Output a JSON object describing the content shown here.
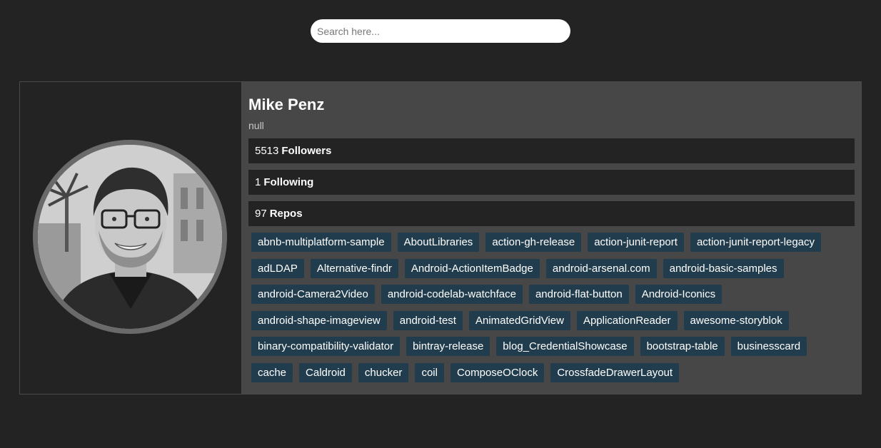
{
  "search": {
    "placeholder": "Search here..."
  },
  "profile": {
    "name": "Mike Penz",
    "bio": "null",
    "stats": [
      {
        "value": "5513",
        "label": "Followers"
      },
      {
        "value": "1",
        "label": "Following"
      },
      {
        "value": "97",
        "label": "Repos"
      }
    ],
    "repos": [
      "abnb-multiplatform-sample",
      "AboutLibraries",
      "action-gh-release",
      "action-junit-report",
      "action-junit-report-legacy",
      "adLDAP",
      "Alternative-findr",
      "Android-ActionItemBadge",
      "android-arsenal.com",
      "android-basic-samples",
      "android-Camera2Video",
      "android-codelab-watchface",
      "android-flat-button",
      "Android-Iconics",
      "android-shape-imageview",
      "android-test",
      "AnimatedGridView",
      "ApplicationReader",
      "awesome-storyblok",
      "binary-compatibility-validator",
      "bintray-release",
      "blog_CredentialShowcase",
      "bootstrap-table",
      "businesscard",
      "cache",
      "Caldroid",
      "chucker",
      "coil",
      "ComposeOClock",
      "CrossfadeDrawerLayout"
    ]
  },
  "colors": {
    "background": "#232323",
    "panel": "#474747",
    "tag": "#213c4c"
  }
}
